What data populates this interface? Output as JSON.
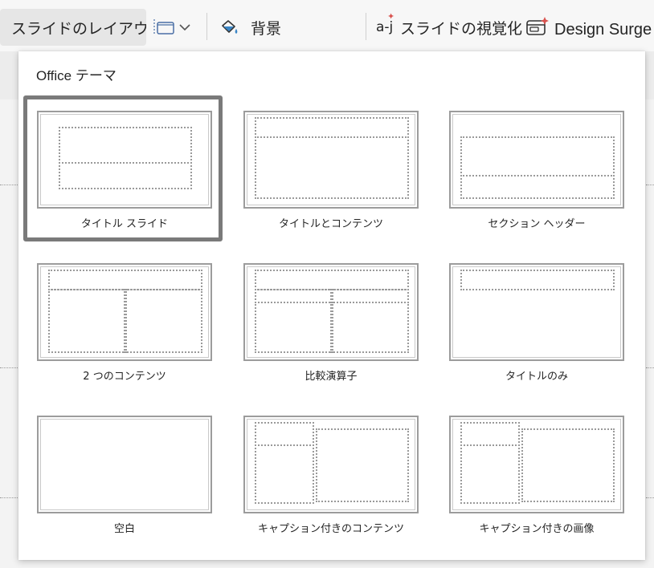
{
  "toolbar": {
    "layout_label": "スライドのレイアウト",
    "background_label": "背景",
    "visualize_label": "スライドの視覚化",
    "visualize_icon_text": "a-j",
    "design_label": "Design Surge"
  },
  "panel": {
    "title": "Office テーマ",
    "layouts": [
      {
        "label": "タイトル スライド",
        "selected": true
      },
      {
        "label": "タイトルとコンテンツ"
      },
      {
        "label": "セクション ヘッダー"
      },
      {
        "label": "2 つのコンテンツ"
      },
      {
        "label": "比較演算子"
      },
      {
        "label": "タイトルのみ"
      },
      {
        "label": "空白"
      },
      {
        "label": "キャプション付きのコンテンツ"
      },
      {
        "label": "キャプション付きの画像"
      }
    ]
  },
  "colors": {
    "selection_border": "#7a7a7a",
    "placeholder_dots": "#9a9a9a"
  }
}
